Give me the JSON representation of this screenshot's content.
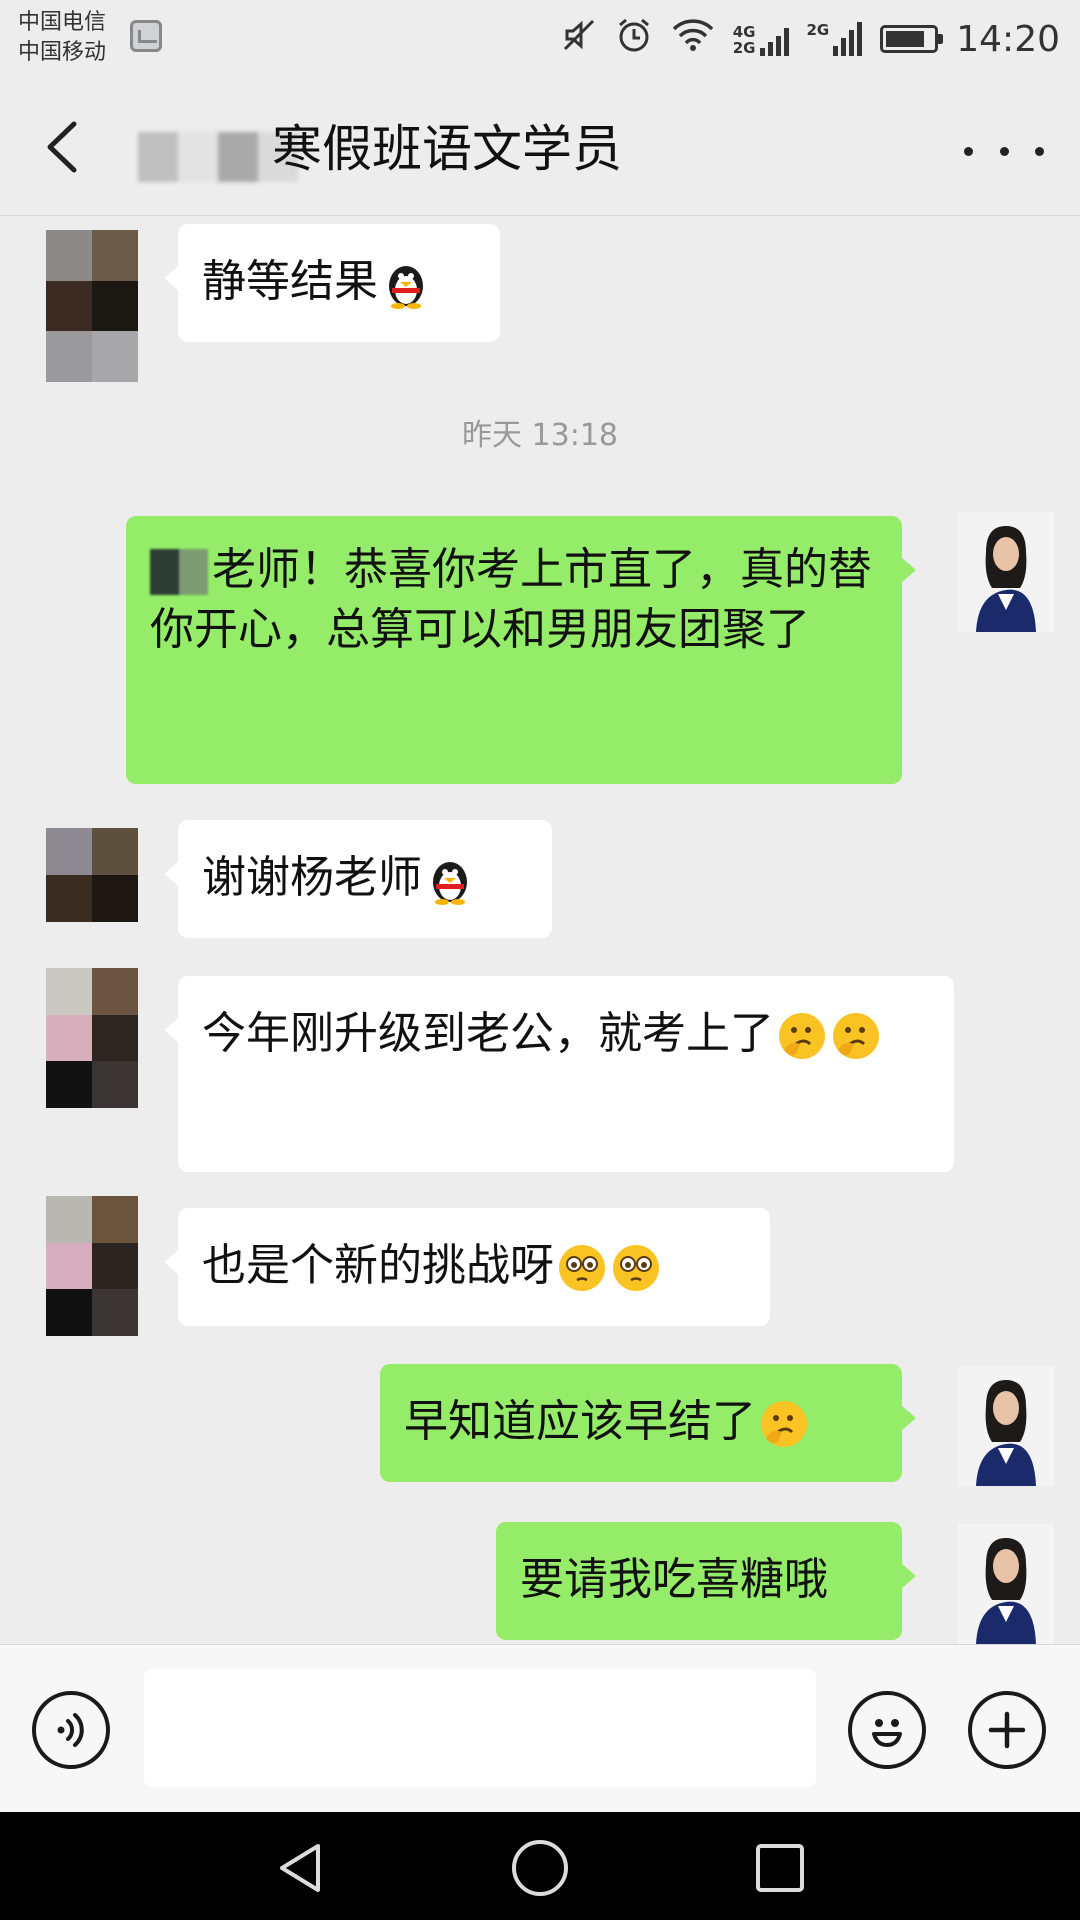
{
  "status_bar": {
    "carrier_1": "中国电信",
    "carrier_2": "中国移动",
    "net_1_top": "4G",
    "net_1_bottom": "2G",
    "net_2": "2G",
    "time": "14:20"
  },
  "header": {
    "title": "寒假班语文学员",
    "back_icon": "chevron-left-icon",
    "more_icon": "more-dots-icon"
  },
  "chat": {
    "timestamp": "昨天 13:18",
    "messages": [
      {
        "side": "left",
        "text": "静等结果",
        "emoji": "penguin-emoji"
      },
      {
        "side": "right",
        "text": "老师！恭喜你考上市直了，真的替你开心，总算可以和男朋友团聚了"
      },
      {
        "side": "left",
        "text": "谢谢杨老师",
        "emoji": "penguin-emoji"
      },
      {
        "side": "left",
        "text": "今年刚升级到老公，就考上了",
        "emoji": "thinking-face-emoji"
      },
      {
        "side": "left",
        "text": "也是个新的挑战呀",
        "emoji": "pleading-face-emoji"
      },
      {
        "side": "right",
        "text": "早知道应该早结了",
        "emoji": "thinking-face-emoji"
      },
      {
        "side": "right",
        "text": "要请我吃喜糖哦"
      }
    ]
  },
  "input_bar": {
    "placeholder": "",
    "voice_icon": "voice-icon",
    "emoji_icon": "smiley-icon",
    "plus_icon": "plus-icon"
  },
  "colors": {
    "background": "#ededed",
    "bubble_self": "#95ec69",
    "bubble_other": "#ffffff"
  }
}
